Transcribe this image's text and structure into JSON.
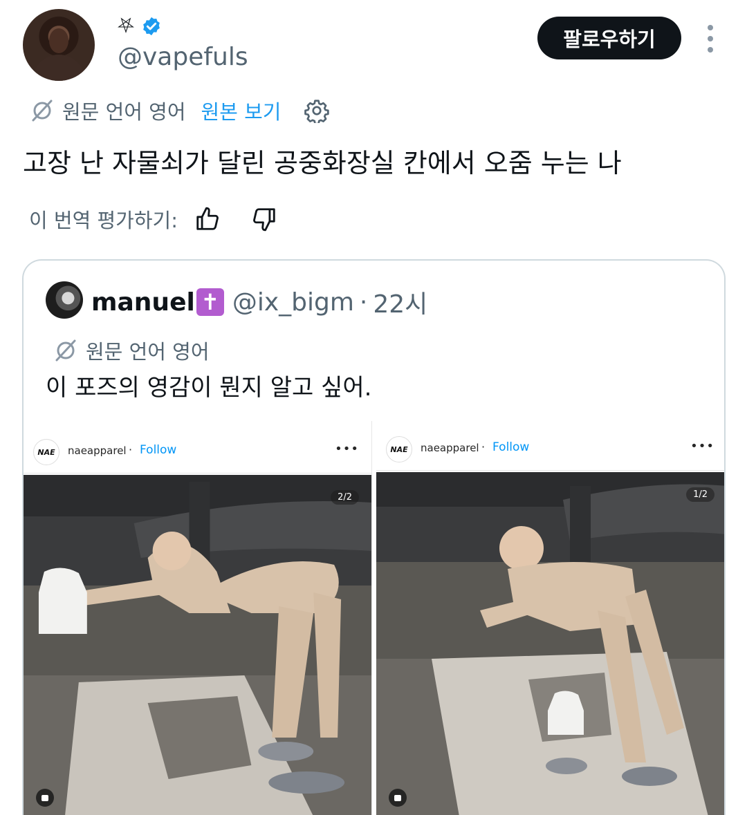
{
  "author": {
    "name_glyph": "⛧",
    "handle": "@vapefuls",
    "verified": true
  },
  "follow_button": {
    "label": "팔로우하기"
  },
  "translation": {
    "original_language": "원문 언어 영어",
    "show_original": "원본 보기"
  },
  "tweet": {
    "text": "고장 난 자물쇠가 달린 공중화장실 칸에서 오줌 누는 나"
  },
  "rate": {
    "label": "이 번역 평가하기:"
  },
  "quote": {
    "name": "manuel",
    "emoji": "✝",
    "handle": "@ix_bigm",
    "time": "22시",
    "original_language": "원문 언어 영어",
    "text": "이 포즈의 영감이 뭔지 알고 싶어.",
    "media": [
      {
        "account": "naeapparel",
        "follow": "Follow",
        "logo": "NAE",
        "more": "•••",
        "page": "2/2"
      },
      {
        "account": "naeapparel",
        "follow": "Follow",
        "logo": "NAE",
        "more": "•••",
        "page": "1/2"
      }
    ]
  },
  "colors": {
    "link": "#1d9bf0",
    "secondary_text": "#536471",
    "ig_follow": "#0095f6"
  }
}
